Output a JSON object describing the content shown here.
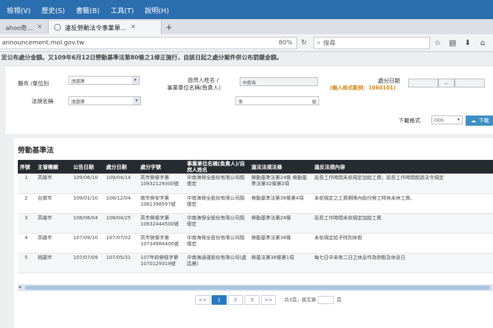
{
  "menu": [
    "檢視(V)",
    "歷史(S)",
    "書籤(B)",
    "工具(T)",
    "說明(H)"
  ],
  "tabs": [
    {
      "label": "ahoo奇…"
    },
    {
      "label": "違反勞動法令事業單…"
    }
  ],
  "url": "announcement.mol.gov.tw",
  "zoom": "80%",
  "search_placeholder": "搜尋",
  "notice": "定公布處分金額。又109年6月12日勞動基準法第80條之1修正施行，自該日起之處分案件併公布罰鍰金額。",
  "form": {
    "county_label": "縣市 /單位別",
    "county_value": "請選擇",
    "law_label": "法規名稱",
    "law_value": "請選擇",
    "name_label_1": "自然人姓名 /",
    "name_label_2": "事業單位名稱(負責人)",
    "name_value": "中南海",
    "doc_prefix": "第",
    "doc_suffix": "號",
    "date_label": "處分日期",
    "date_hint": "(輸入格式範例：1060101)",
    "date_sep": "~",
    "format_label": "下載格式",
    "format_value": "ODS",
    "download_label": "下載"
  },
  "section_title": "勞動基準法",
  "table": {
    "headers": [
      "序號",
      "主管機關",
      "公告日期",
      "處分日期",
      "處分字號",
      "事業單位名稱(負責人)/自然人姓名",
      "違法法規法條",
      "違反法規內容"
    ],
    "rows": [
      [
        "1",
        "高雄市",
        "109/06/10",
        "109/04/14",
        "高市勞條字第10932129300號",
        "中南海保全股份有限公司顏復宏",
        "勞動基準法第24條 勞動基準法第32條第2項",
        "延長工作時間未依規定加給工資；延長工作時間超過法令規定"
      ],
      [
        "2",
        "台南市",
        "109/01/10",
        "108/12/04",
        "南市勞安字第1081398597號",
        "中南海保全股份有限公司顏復宏",
        "勞動基準法第38條第4項",
        "未依規定之工資期限內給付勞工特休未休工資。"
      ],
      [
        "3",
        "高雄市",
        "108/06/04",
        "108/04/25",
        "高市勞條字第10832444500號",
        "中南海保全股份有限公司顏復宏",
        "勞動基準法第24條",
        "延長工作時間未依規定加給工資"
      ],
      [
        "4",
        "高雄市",
        "107/09/10",
        "107/07/02",
        "高市勞條字第10734984400號",
        "中南海保全股份有限公司顏復宏",
        "勞動基準法第38條",
        "未依規定給予特別休假"
      ],
      [
        "5",
        "桃園市",
        "107/07/09",
        "107/05/31",
        "107年府勞條字第1070129319號",
        "中南海通運股份有限公司(盧廷晨)",
        "勞基法第36條第1項",
        "每七日中未有二日之休息作為例假及休息日"
      ]
    ]
  },
  "pager": {
    "prev": "<<",
    "pages": [
      "1",
      "2",
      "3"
    ],
    "next": ">>",
    "active_page": "1",
    "info_prefix": "共3頁，跳至第",
    "info_suffix": "頁"
  },
  "colors": {
    "menubar": "#2c6fb0",
    "header_row": "#262b31",
    "accent": "#2a7ac3",
    "hint": "#d4891a"
  }
}
